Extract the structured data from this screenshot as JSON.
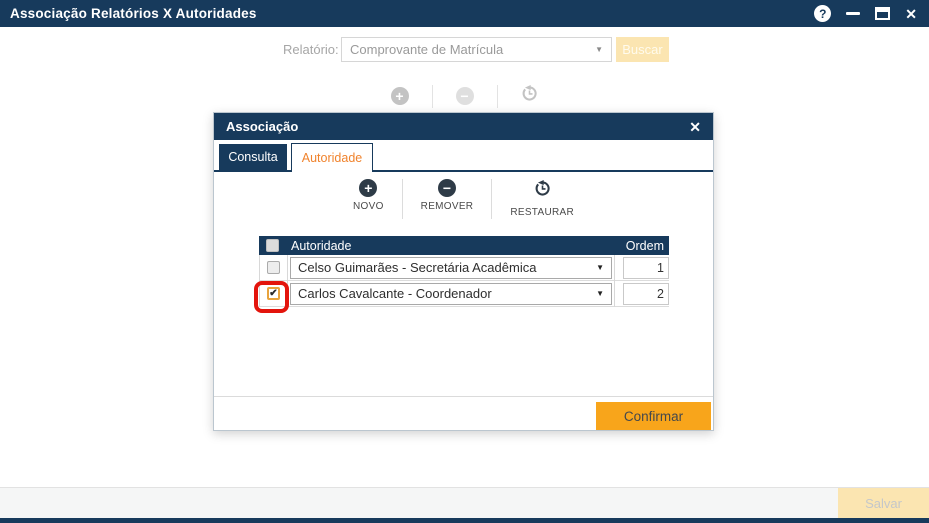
{
  "window": {
    "title": "Associação Relatórios X Autoridades"
  },
  "icons": {
    "help": "?",
    "close": "✕",
    "dropdown": "▼",
    "plus": "+",
    "minus": "−",
    "check": "✔"
  },
  "report_bar": {
    "label": "Relatório:",
    "report_value": "Comprovante de Matrícula",
    "search_button": "Buscar"
  },
  "modal": {
    "title": "Associação",
    "tabs": [
      {
        "label": "Consulta",
        "active": false
      },
      {
        "label": "Autoridade",
        "active": true
      }
    ],
    "toolbar": {
      "new": "NOVO",
      "remove": "REMOVER",
      "restore": "RESTAURAR"
    },
    "table": {
      "header_authority": "Autoridade",
      "header_order": "Ordem",
      "rows": [
        {
          "authority": "Celso Guimarães - Secretária Acadêmica",
          "order": "1",
          "checked": false
        },
        {
          "authority": "Carlos Cavalcante - Coordenador",
          "order": "2",
          "checked": true
        }
      ]
    },
    "confirm_button": "Confirmar"
  },
  "footer": {
    "save_button": "Salvar"
  },
  "colors": {
    "navy": "#173A5C",
    "accent_orange": "#F8A51B",
    "tab_active_text": "#F0832D",
    "disabled_button_bg": "#FBE5B1",
    "annotation_red": "#E3140C"
  }
}
